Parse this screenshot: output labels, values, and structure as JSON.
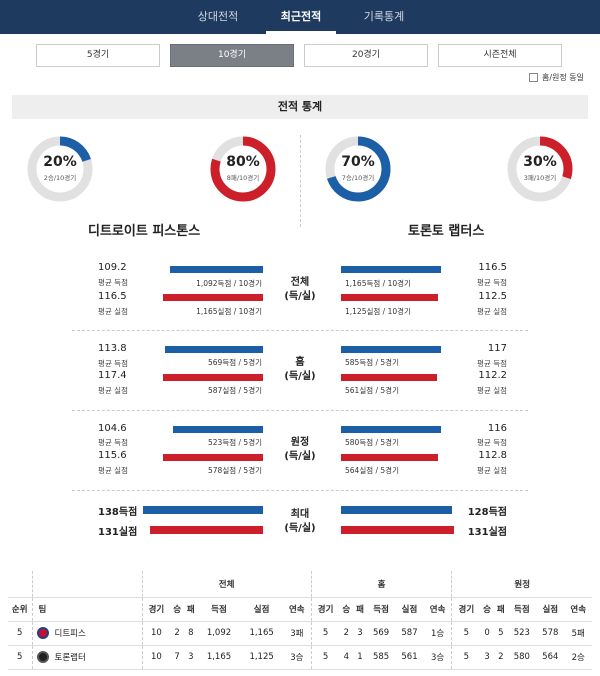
{
  "nav": {
    "tabs": [
      "상대전적",
      "최근전적",
      "기록통계"
    ],
    "active": 1
  },
  "periods": {
    "buttons": [
      "5경기",
      "10경기",
      "20경기",
      "시즌전체"
    ],
    "active": 1
  },
  "home_away_toggle": {
    "label": "홈/원정 동일",
    "checked": false
  },
  "section_title": "전적 통계",
  "donuts": [
    {
      "pct": "20%",
      "sub": "2승/10경기",
      "fraction": 0.2,
      "color": "#1d5fa6"
    },
    {
      "pct": "80%",
      "sub": "8패/10경기",
      "fraction": 0.8,
      "color": "#cc1f2a"
    },
    {
      "pct": "70%",
      "sub": "7승/10경기",
      "fraction": 0.7,
      "color": "#1d5fa6"
    },
    {
      "pct": "30%",
      "sub": "3패/10경기",
      "fraction": 0.3,
      "color": "#cc1f2a"
    }
  ],
  "teams": {
    "left": "디트로이트 피스톤스",
    "right": "토론토 랩터스"
  },
  "stat_groups": [
    {
      "label_line1": "전체",
      "label_line2": "(득/실)",
      "left": {
        "scored": {
          "value": "109.2",
          "label": "평균 득점",
          "note": "1,092득점 / 10경기"
        },
        "allowed": {
          "value": "116.5",
          "label": "평균 실점",
          "note": "1,165실점 / 10경기"
        }
      },
      "right": {
        "scored": {
          "value": "116.5",
          "label": "평균 득점",
          "note": "1,165득점 / 10경기"
        },
        "allowed": {
          "value": "112.5",
          "label": "평균 실점",
          "note": "1,125실점 / 10경기"
        }
      }
    },
    {
      "label_line1": "홈",
      "label_line2": "(득/실)",
      "left": {
        "scored": {
          "value": "113.8",
          "label": "평균 득점",
          "note": "569득점 / 5경기"
        },
        "allowed": {
          "value": "117.4",
          "label": "평균 실점",
          "note": "587실점 / 5경기"
        }
      },
      "right": {
        "scored": {
          "value": "117",
          "label": "평균 득점",
          "note": "585득점 / 5경기"
        },
        "allowed": {
          "value": "112.2",
          "label": "평균 실점",
          "note": "561실점 / 5경기"
        }
      }
    },
    {
      "label_line1": "원정",
      "label_line2": "(득/실)",
      "left": {
        "scored": {
          "value": "104.6",
          "label": "평균 득점",
          "note": "523득점 / 5경기"
        },
        "allowed": {
          "value": "115.6",
          "label": "평균 실점",
          "note": "578실점 / 5경기"
        }
      },
      "right": {
        "scored": {
          "value": "116",
          "label": "평균 득점",
          "note": "580득점 / 5경기"
        },
        "allowed": {
          "value": "112.8",
          "label": "평균 실점",
          "note": "564실점 / 5경기"
        }
      }
    }
  ],
  "max_group": {
    "label_line1": "최대",
    "label_line2": "(득/실)",
    "left": {
      "scored": "138득점",
      "allowed": "131실점"
    },
    "right": {
      "scored": "128득점",
      "allowed": "131실점"
    }
  },
  "standings": {
    "group_headers": [
      "전체",
      "홈",
      "원정"
    ],
    "col_rank": "순위",
    "col_team": "팀",
    "cols": [
      "경기",
      "승",
      "패",
      "득점",
      "실점",
      "연속"
    ],
    "rows": [
      {
        "rank": "5",
        "team": "디트피스",
        "logo": "pistons-logo",
        "total": [
          "10",
          "2",
          "8",
          "1,092",
          "1,165",
          "3패"
        ],
        "home": [
          "5",
          "2",
          "3",
          "569",
          "587",
          "1승"
        ],
        "away": [
          "5",
          "0",
          "5",
          "523",
          "578",
          "5패"
        ]
      },
      {
        "rank": "5",
        "team": "토론랩터",
        "logo": "raptors-logo",
        "total": [
          "10",
          "7",
          "3",
          "1,165",
          "1,125",
          "3승"
        ],
        "home": [
          "5",
          "4",
          "1",
          "585",
          "561",
          "3승"
        ],
        "away": [
          "5",
          "3",
          "2",
          "580",
          "564",
          "2승"
        ]
      }
    ]
  }
}
